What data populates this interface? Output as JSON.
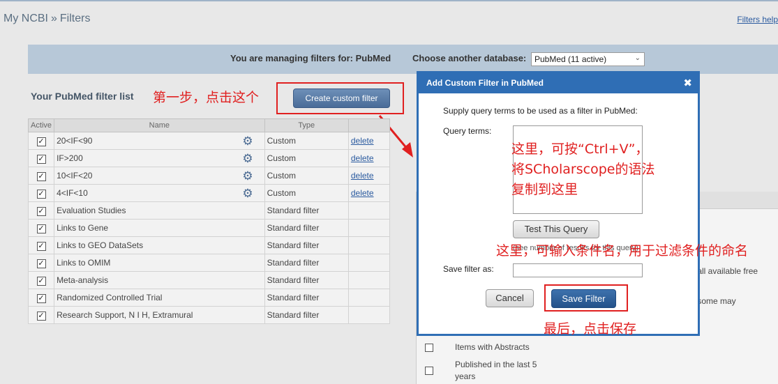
{
  "breadcrumb": {
    "home": "My NCBI",
    "sep": "»",
    "current": "Filters"
  },
  "help_link": "Filters help",
  "db_bar": {
    "managing": "You are managing filters for: PubMed",
    "choose": "Choose another database:",
    "selected": "PubMed (11 active)"
  },
  "list_title": "Your PubMed filter list",
  "create_button": "Create custom filter",
  "annotations": {
    "step1": "第一步，点击这个",
    "paste": "这里，可按“Ctrl+V”，将SCholarscope的语法复制到这里",
    "name": "这里，可输入条件名，用于过滤条件的命名",
    "save": "最后，点击保存"
  },
  "table": {
    "headers": {
      "active": "Active",
      "name": "Name",
      "type": "Type",
      "delete": "delete"
    },
    "rows": [
      {
        "name": "20<IF<90",
        "type": "Custom",
        "delete": "delete"
      },
      {
        "name": "IF>200",
        "type": "Custom",
        "delete": "delete"
      },
      {
        "name": "10<IF<20",
        "type": "Custom",
        "delete": "delete"
      },
      {
        "name": "4<IF<10",
        "type": "Custom",
        "delete": "delete"
      },
      {
        "name": "Evaluation Studies",
        "type": "Standard filter",
        "delete": ""
      },
      {
        "name": "Links to Gene",
        "type": "Standard filter",
        "delete": ""
      },
      {
        "name": "Links to GEO DataSets",
        "type": "Standard filter",
        "delete": ""
      },
      {
        "name": "Links to OMIM",
        "type": "Standard filter",
        "delete": ""
      },
      {
        "name": "Meta-analysis",
        "type": "Standard filter",
        "delete": ""
      },
      {
        "name": "Randomized Controlled Trial",
        "type": "Standard filter",
        "delete": ""
      },
      {
        "name": "Research Support, N I H, Extramural",
        "type": "Standard filter",
        "delete": ""
      }
    ]
  },
  "right_panel": {
    "text1": "s (all available free",
    "text2": "s (some may",
    "item1": "Items with Abstracts",
    "item2a": "Published in the last 5",
    "item2b": "years"
  },
  "modal": {
    "title": "Add Custom Filter in PubMed",
    "close": "✖",
    "supply": "Supply query terms to be used as a filter in PubMed:",
    "query_label": "Query terms:",
    "test_button": "Test This Query",
    "hint": "(see number of results for this query)",
    "save_as_label": "Save filter as:",
    "cancel_button": "Cancel",
    "save_button": "Save Filter"
  },
  "colors": {
    "accent": "#2f6eb5",
    "annotation": "#e02020"
  }
}
